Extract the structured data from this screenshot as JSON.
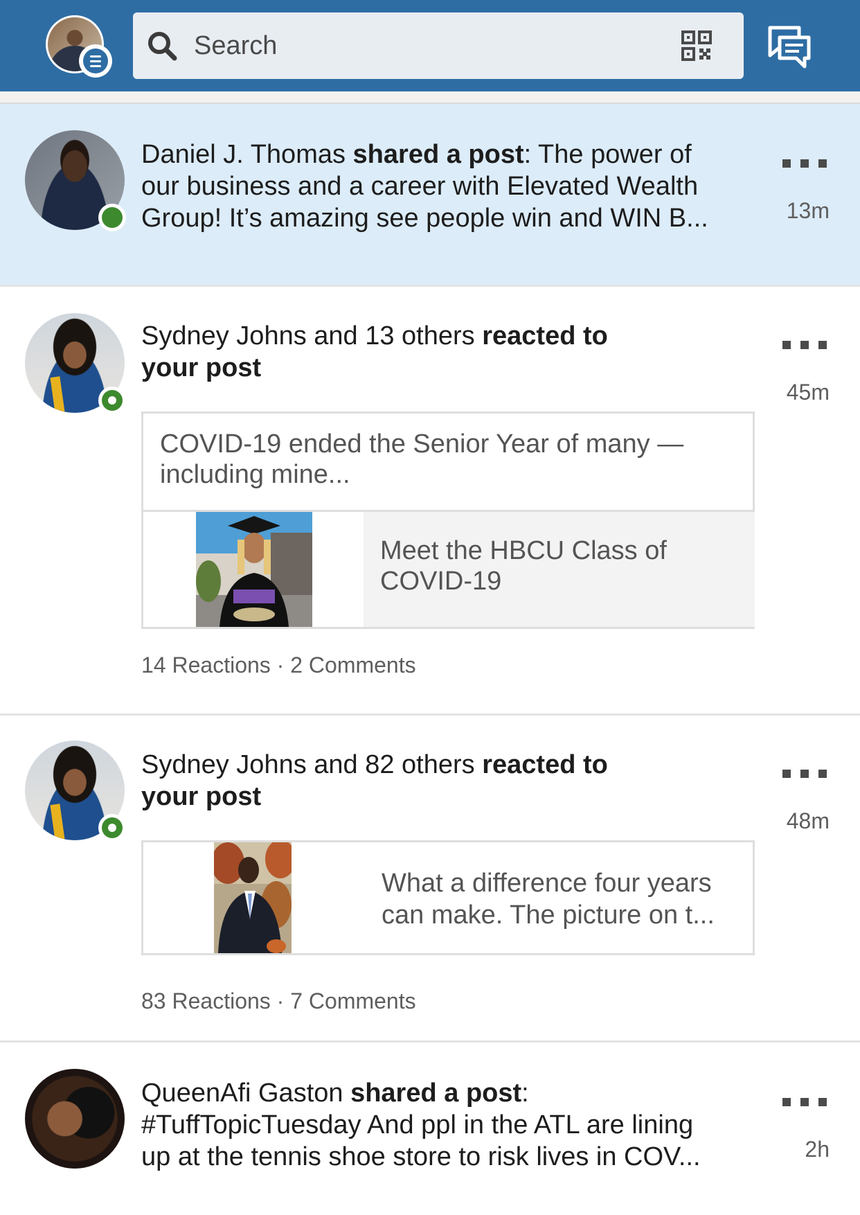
{
  "header": {
    "search_placeholder": "Search",
    "icons": {
      "search": "search-icon",
      "qr": "qr-code-icon",
      "messaging": "messaging-icon",
      "menu_badge": "menu-icon"
    }
  },
  "colors": {
    "header": "#2e6da4",
    "unread_row": "#dcecf9",
    "presence": "#3d8a2e"
  },
  "notifications": [
    {
      "actor": "Daniel J. Thomas",
      "action": "shared a post",
      "line1_after": ": The power of",
      "line2": "our business and a career with Elevated Wealth",
      "line3": "Group! It’s amazing see people win and WIN B...",
      "time": "13m",
      "presence": "active",
      "unread": true
    },
    {
      "actor": "Sydney Johns and 13 others",
      "action_line1": "reacted to",
      "action_line2": "your post",
      "time": "45m",
      "presence": "away",
      "card": {
        "post_line1": "COVID-19 ended the Senior Year of many —",
        "post_line2": "including mine...",
        "link_line1": "Meet the HBCU Class of",
        "link_line2": "COVID-19"
      },
      "reactions": "14 Reactions",
      "separator": "·",
      "comments": "2 Comments"
    },
    {
      "actor": "Sydney Johns and 82 others",
      "action_line1": "reacted to",
      "action_line2": "your post",
      "time": "48m",
      "presence": "away",
      "card": {
        "text_line1": "What a difference four years",
        "text_line2": "can make. The picture on t..."
      },
      "reactions": "83 Reactions",
      "separator": "·",
      "comments": "7 Comments"
    },
    {
      "actor": "QueenAfi Gaston",
      "action": "shared a post",
      "line1_after": ":",
      "line2": "#TuffTopicTuesday And ppl in the ATL are lining",
      "line3": "up at the tennis shoe store to risk lives in COV...",
      "time": "2h"
    }
  ]
}
